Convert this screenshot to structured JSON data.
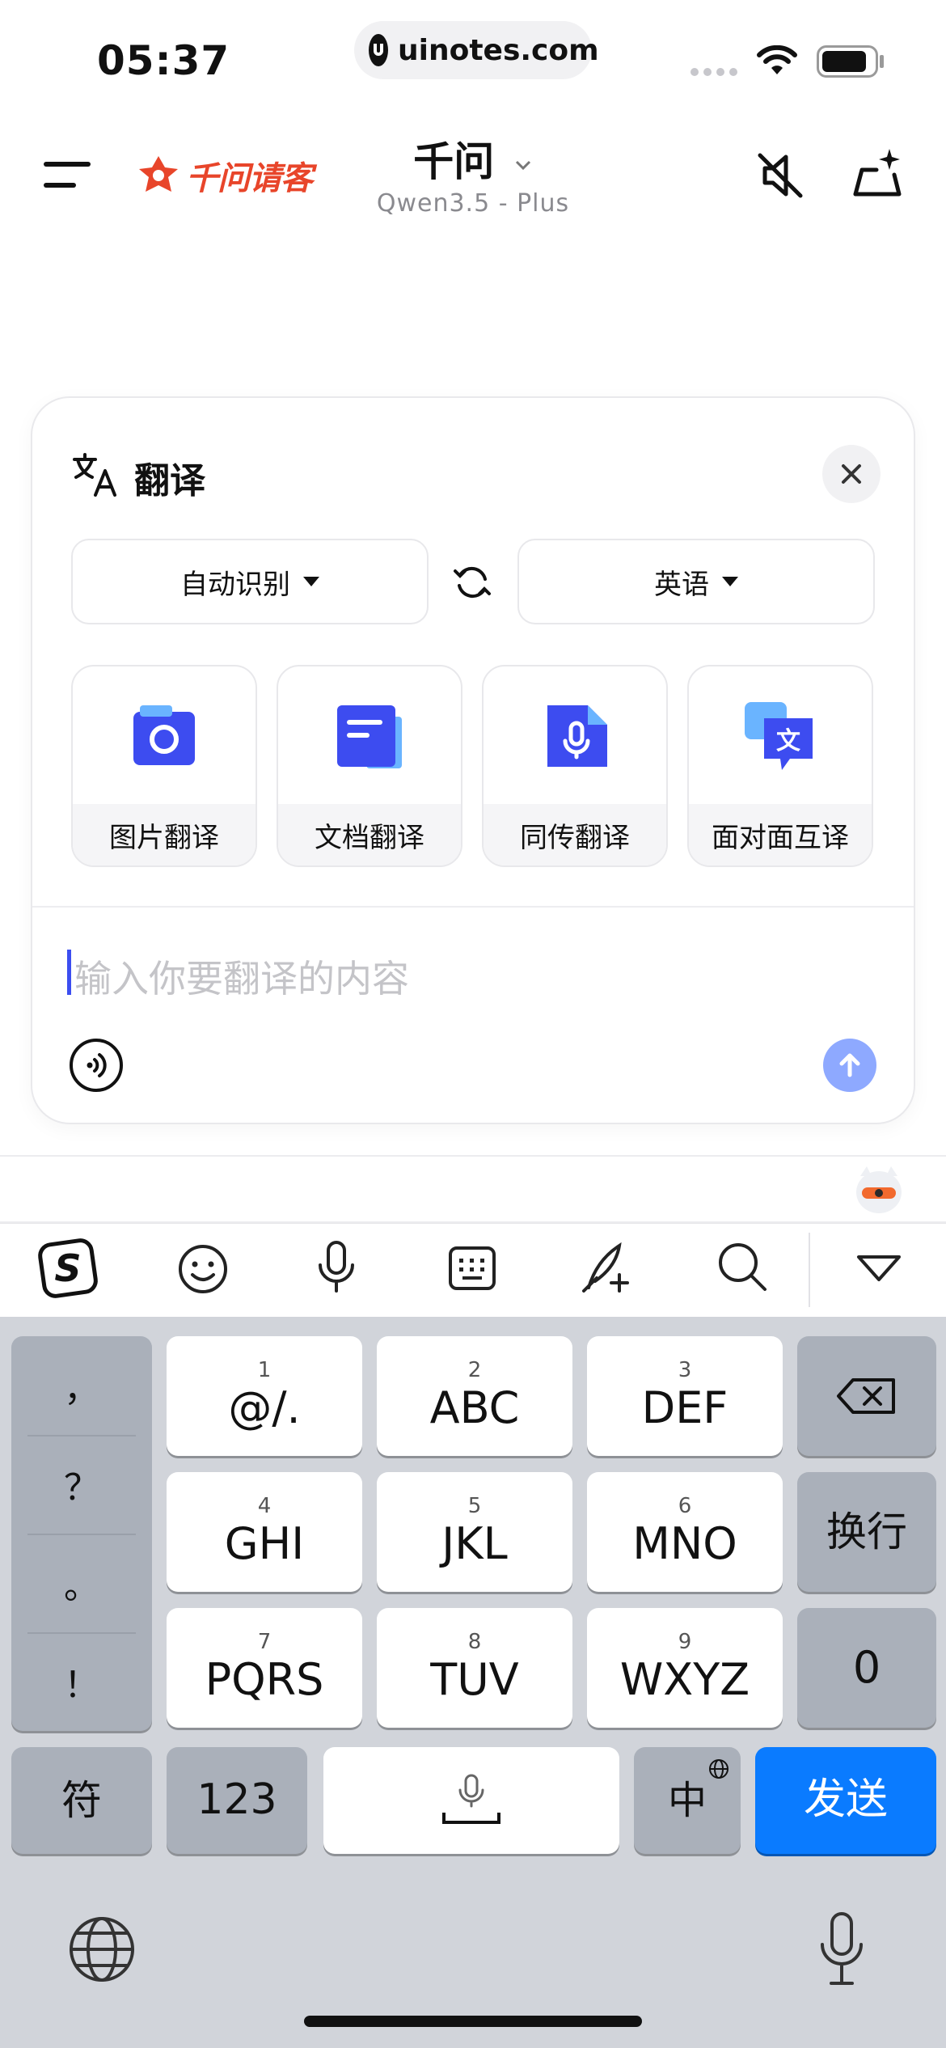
{
  "status_bar": {
    "time": "05:37",
    "url": "uinotes.com"
  },
  "header": {
    "brand": "千问请客",
    "title": "千问",
    "subtitle": "Qwen3.5 - Plus",
    "icons": [
      "menu-icon",
      "mute-icon",
      "new-chat-sparkle-icon"
    ]
  },
  "translate_card": {
    "title": "翻译",
    "source_lang": "自动识别",
    "target_lang": "英语",
    "tools": [
      {
        "label": "图片翻译",
        "icon": "camera-icon"
      },
      {
        "label": "文档翻译",
        "icon": "document-icon"
      },
      {
        "label": "同传翻译",
        "icon": "microphone-icon"
      },
      {
        "label": "面对面互译",
        "icon": "face-to-face-translate-icon"
      }
    ],
    "input_placeholder": "输入你要翻译的内容"
  },
  "keyboard": {
    "toolbar_icons": [
      "sogou-logo-icon",
      "emoji-icon",
      "voice-input-icon",
      "keyboard-icon",
      "handwriting-icon",
      "search-icon",
      "collapse-icon"
    ],
    "punctuation": [
      "，",
      "？",
      "。",
      "！"
    ],
    "keys": [
      {
        "num": "1",
        "label": "@/."
      },
      {
        "num": "2",
        "label": "ABC"
      },
      {
        "num": "3",
        "label": "DEF"
      },
      {
        "num": "4",
        "label": "GHI"
      },
      {
        "num": "5",
        "label": "JKL"
      },
      {
        "num": "6",
        "label": "MNO"
      },
      {
        "num": "7",
        "label": "PQRS"
      },
      {
        "num": "8",
        "label": "TUV"
      },
      {
        "num": "9",
        "label": "WXYZ"
      }
    ],
    "newline": "换行",
    "zero": "0",
    "symbols": "符",
    "numbers": "123",
    "lang_switch": "中",
    "send": "发送",
    "send_color": "#0a7bff"
  }
}
